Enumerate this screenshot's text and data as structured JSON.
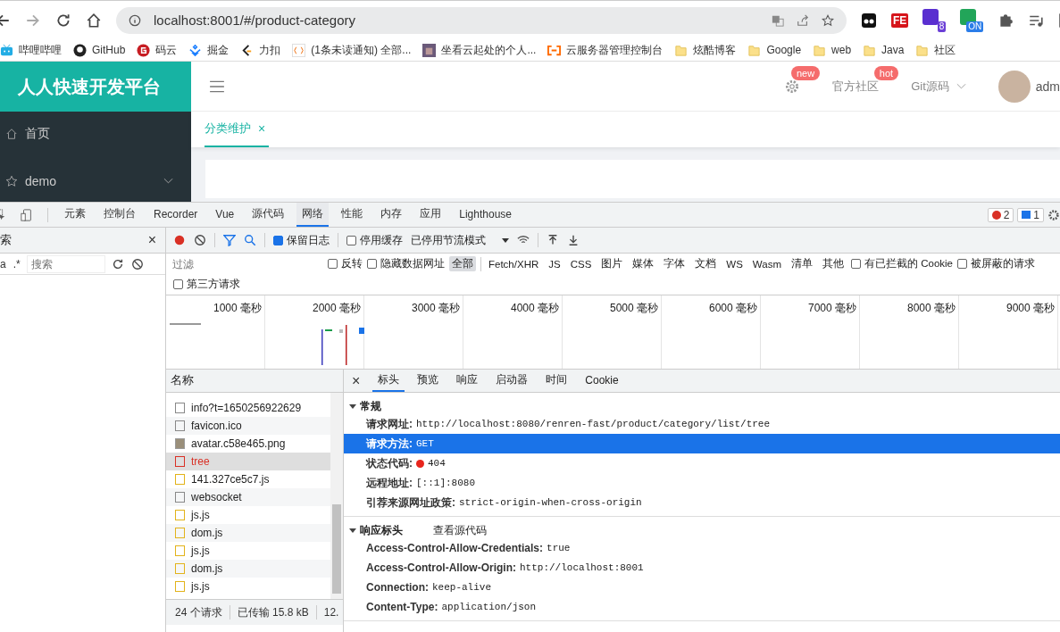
{
  "browser": {
    "url": "localhost:8001/#/product-category",
    "extensions": [
      {
        "kind": "ghost"
      },
      {
        "kind": "fe",
        "text": "FE"
      },
      {
        "kind": "stack",
        "badge": "8"
      },
      {
        "kind": "info",
        "badge": "ON"
      }
    ],
    "bookmarks": [
      {
        "label": "哔哩哔哩",
        "kind": "tv"
      },
      {
        "label": "GitHub",
        "kind": "github"
      },
      {
        "label": "码云",
        "kind": "gitee"
      },
      {
        "label": "掘金",
        "kind": "juejin"
      },
      {
        "label": "力扣",
        "kind": "leetcode"
      },
      {
        "label": "(1条未读通知) 全部...",
        "kind": "notice"
      },
      {
        "label": "坐看云起处的个人...",
        "kind": "photo"
      },
      {
        "label": "云服务器管理控制台",
        "kind": "aliyun"
      },
      {
        "label": "炫酷博客",
        "kind": "folder"
      },
      {
        "label": "Google",
        "kind": "folder"
      },
      {
        "label": "web",
        "kind": "folder"
      },
      {
        "label": "Java",
        "kind": "folder"
      },
      {
        "label": "社区",
        "kind": "folder"
      }
    ]
  },
  "app": {
    "logo": "人人快速开发平台",
    "header": {
      "settings_badge": "new",
      "community": "官方社区",
      "community_badge": "hot",
      "git": "Git源码",
      "user": "adm"
    },
    "sidebar": [
      {
        "label": "首页",
        "kind": "home"
      },
      {
        "label": "demo",
        "kind": "star"
      }
    ],
    "tabs": [
      {
        "label": "分类维护",
        "selected": true,
        "close": "×"
      }
    ]
  },
  "devtools": {
    "tabs": [
      {
        "label": "元素",
        "selected": false
      },
      {
        "label": "控制台",
        "selected": false
      },
      {
        "label": "Recorder",
        "selected": false
      },
      {
        "label": "Vue",
        "selected": false
      },
      {
        "label": "源代码",
        "selected": false
      },
      {
        "label": "网络",
        "selected": true
      },
      {
        "label": "性能",
        "selected": false
      },
      {
        "label": "内存",
        "selected": false
      },
      {
        "label": "应用",
        "selected": false
      },
      {
        "label": "Lighthouse",
        "selected": false
      }
    ],
    "errors": "2",
    "messages": "1",
    "search_panel": {
      "title": "索",
      "close": "×",
      "case_toggle": "a",
      "regex_toggle": ".*",
      "placeholder": "搜索"
    },
    "toolbar": {
      "preserve_log": {
        "label": "保留日志",
        "checked": true
      },
      "disable_cache": {
        "label": "停用缓存",
        "checked": false
      },
      "throttling": "已停用节流模式"
    },
    "filter": {
      "placeholder": "过滤",
      "invert": {
        "label": "反转",
        "checked": false
      },
      "hide_data_urls": {
        "label": "隐藏数据网址",
        "checked": false
      },
      "types": [
        {
          "label": "全部",
          "selected": true
        },
        {
          "label": "Fetch/XHR",
          "selected": false
        },
        {
          "label": "JS",
          "selected": false
        },
        {
          "label": "CSS",
          "selected": false
        },
        {
          "label": "图片",
          "selected": false
        },
        {
          "label": "媒体",
          "selected": false
        },
        {
          "label": "字体",
          "selected": false
        },
        {
          "label": "文档",
          "selected": false
        },
        {
          "label": "WS",
          "selected": false
        },
        {
          "label": "Wasm",
          "selected": false
        },
        {
          "label": "清单",
          "selected": false
        },
        {
          "label": "其他",
          "selected": false
        }
      ],
      "blocked_cookies": {
        "label": "有已拦截的 Cookie",
        "checked": false
      },
      "blocked_requests": {
        "label": "被屏蔽的请求",
        "checked": false
      },
      "third_party": {
        "label": "第三方请求",
        "checked": false
      }
    },
    "timeline_ticks": [
      "1000 毫秒",
      "2000 毫秒",
      "3000 毫秒",
      "4000 毫秒",
      "5000 毫秒",
      "6000 毫秒",
      "7000 毫秒",
      "8000 毫秒",
      "9000 毫秒"
    ],
    "requests": {
      "column": "名称",
      "rows": [
        {
          "name": "info?t=1650256922629",
          "kind": "doc",
          "failed": false,
          "selected": false
        },
        {
          "name": "favicon.ico",
          "kind": "doc",
          "failed": false,
          "selected": false
        },
        {
          "name": "avatar.c58e465.png",
          "kind": "image",
          "failed": false,
          "selected": false
        },
        {
          "name": "tree",
          "kind": "doc",
          "failed": true,
          "selected": true
        },
        {
          "name": "141.327ce5c7.js",
          "kind": "script",
          "failed": false,
          "selected": false
        },
        {
          "name": "websocket",
          "kind": "doc",
          "failed": false,
          "selected": false
        },
        {
          "name": "js.js",
          "kind": "script",
          "failed": false,
          "selected": false
        },
        {
          "name": "dom.js",
          "kind": "script",
          "failed": false,
          "selected": false
        },
        {
          "name": "js.js",
          "kind": "script",
          "failed": false,
          "selected": false
        },
        {
          "name": "dom.js",
          "kind": "script",
          "failed": false,
          "selected": false
        },
        {
          "name": "js.js",
          "kind": "script",
          "failed": false,
          "selected": false
        }
      ],
      "summary": [
        "24 个请求",
        "已传输 15.8 kB",
        "12."
      ]
    },
    "details": {
      "close": "×",
      "tabs": [
        {
          "label": "标头",
          "selected": true
        },
        {
          "label": "预览",
          "selected": false
        },
        {
          "label": "响应",
          "selected": false
        },
        {
          "label": "启动器",
          "selected": false
        },
        {
          "label": "时间",
          "selected": false
        },
        {
          "label": "Cookie",
          "selected": false
        }
      ],
      "sections": [
        {
          "title": "常规",
          "expanded": true,
          "rows": [
            {
              "key": "请求网址:",
              "value": "http://localhost:8080/renren-fast/product/category/list/tree",
              "selected": false
            },
            {
              "key": "请求方法:",
              "value": "GET",
              "selected": true
            },
            {
              "key": "状态代码:",
              "value": "404",
              "selected": false,
              "failed": true
            },
            {
              "key": "远程地址:",
              "value": "[::1]:8080",
              "selected": false
            },
            {
              "key": "引荐来源网址政策:",
              "value": "strict-origin-when-cross-origin",
              "selected": false
            }
          ]
        },
        {
          "title": "响应标头",
          "expanded": true,
          "link": "查看源代码",
          "rows": [
            {
              "key": "Access-Control-Allow-Credentials:",
              "value": "true",
              "selected": false
            },
            {
              "key": "Access-Control-Allow-Origin:",
              "value": "http://localhost:8001",
              "selected": false
            },
            {
              "key": "Connection:",
              "value": "keep-alive",
              "selected": false
            },
            {
              "key": "Content-Type:",
              "value": "application/json",
              "selected": false
            }
          ]
        }
      ]
    }
  }
}
